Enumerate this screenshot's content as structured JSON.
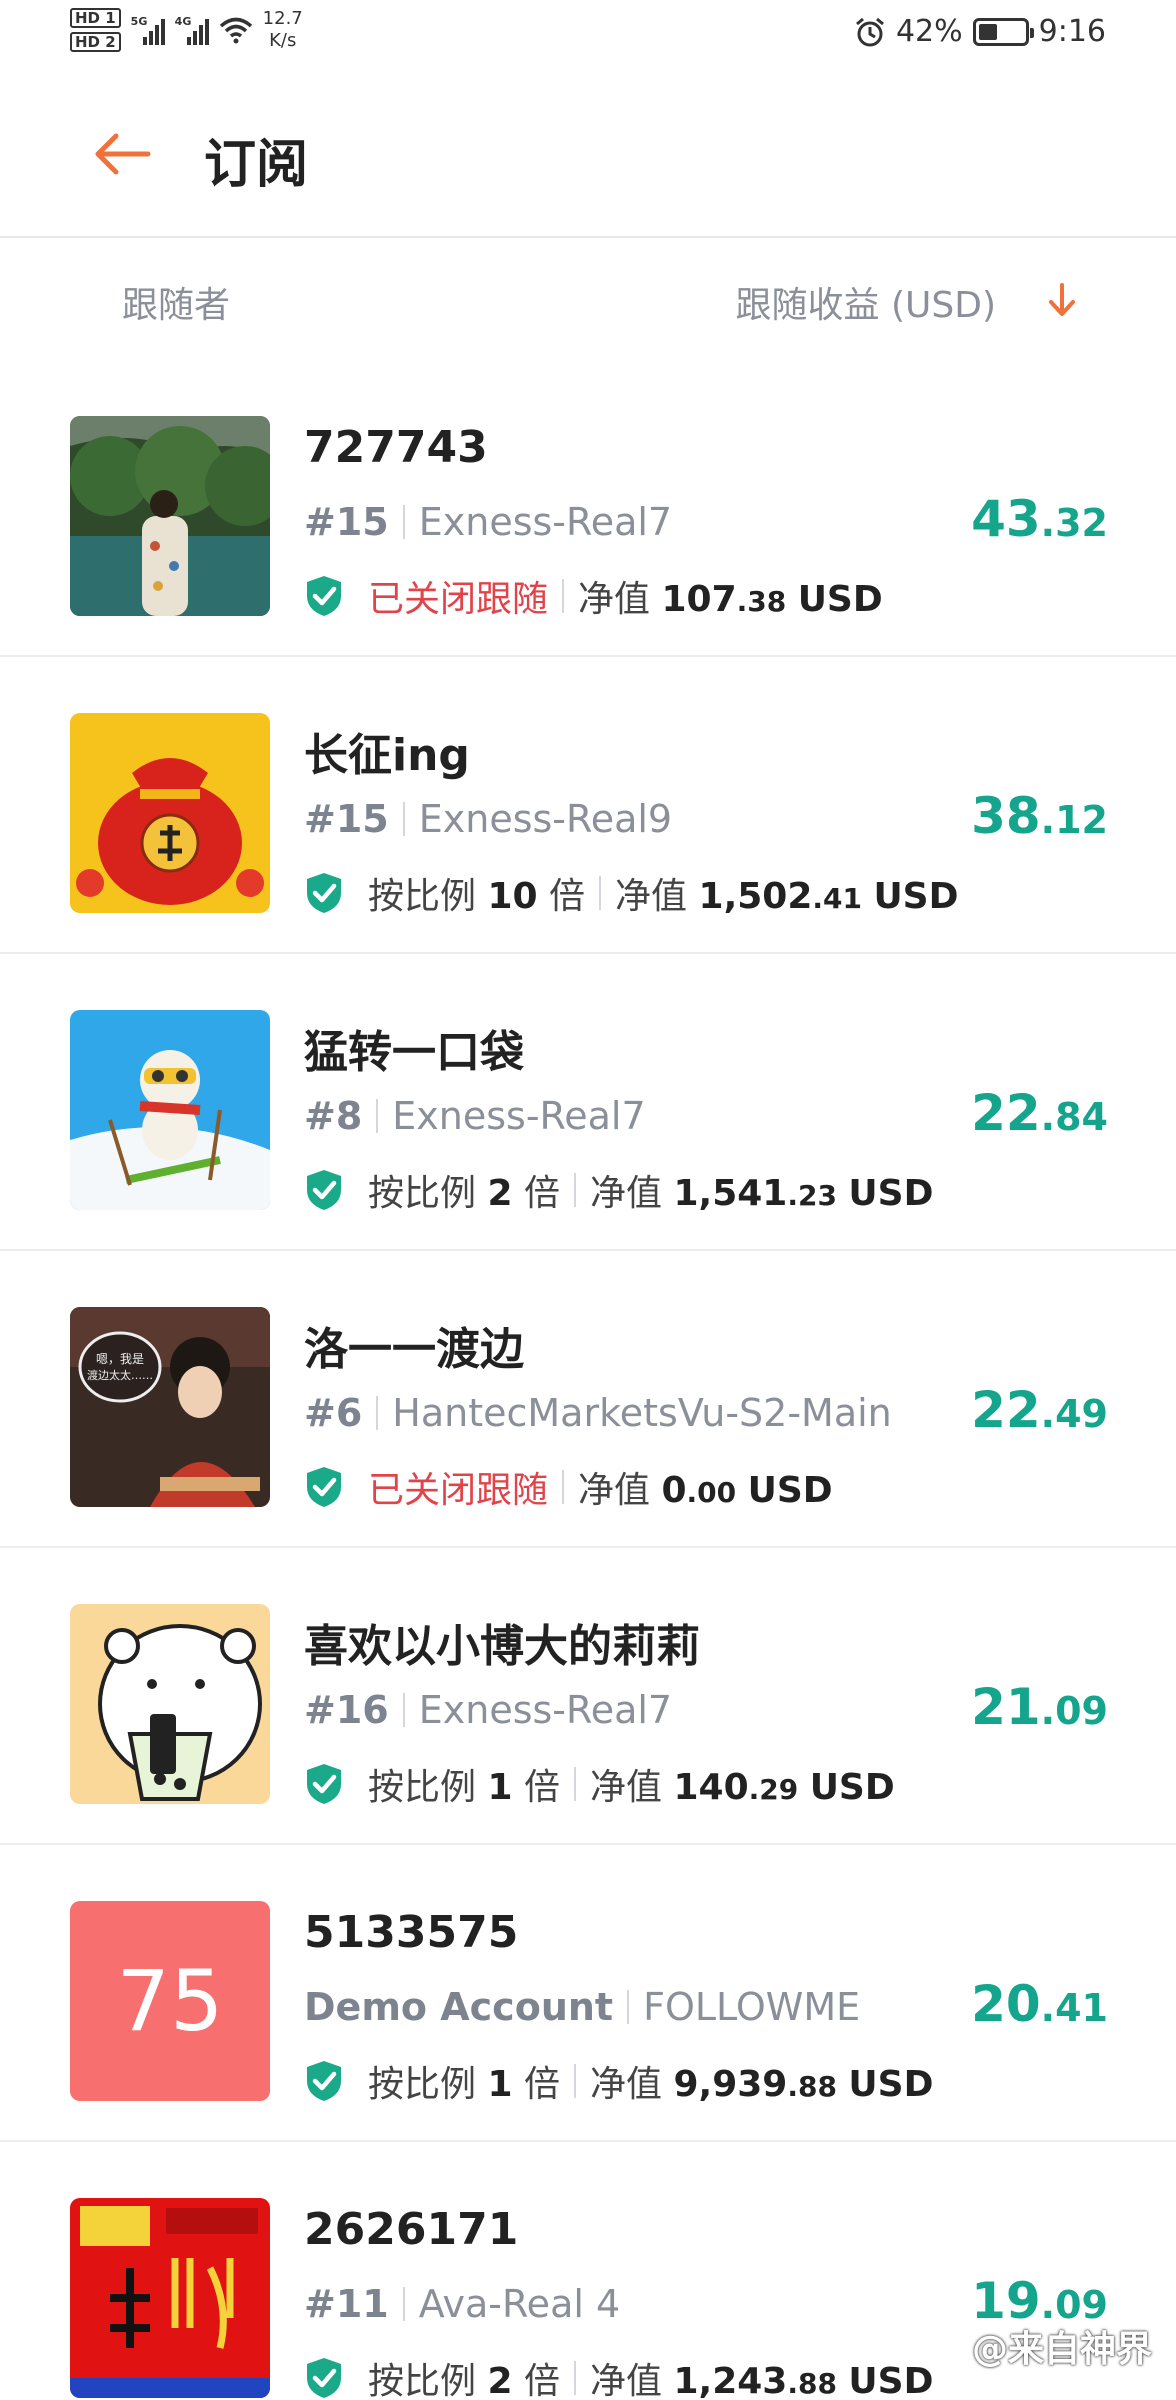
{
  "status_bar": {
    "hd1": "HD 1",
    "hd2": "HD 2",
    "sig1_tag": "5G",
    "sig2_tag": "4G",
    "speed_value": "12.7",
    "speed_unit": "K/s",
    "battery": "42%",
    "battery_level": 0.42,
    "time": "9:16"
  },
  "header": {
    "title": "订阅",
    "back_icon": "arrow-left-icon"
  },
  "columns": {
    "follower": "跟随者",
    "profit": "跟随收益 (USD)",
    "sort_icon": "arrow-down-icon"
  },
  "colors": {
    "accent": "#f0713a",
    "profit": "#15a58c",
    "closed": "#e0444a",
    "shield": "#1aa989"
  },
  "labels": {
    "equity": "净值",
    "currency": "USD"
  },
  "rows": [
    {
      "name": "727743",
      "rank": "#15",
      "server": "Exness-Real7",
      "status": "已关闭跟随",
      "equity_int": "107",
      "equity_dec": ".38",
      "profit_int": "43",
      "profit_dec": ".32"
    },
    {
      "name": "长征ing",
      "rank": "#15",
      "server": "Exness-Real9",
      "ratio_prefix": "按比例",
      "ratio_value": "10",
      "ratio_suffix": "倍",
      "equity_int": "1,502",
      "equity_dec": ".41",
      "profit_int": "38",
      "profit_dec": ".12"
    },
    {
      "name": "猛转一口袋",
      "rank": "#8",
      "server": "Exness-Real7",
      "ratio_prefix": "按比例",
      "ratio_value": "2",
      "ratio_suffix": "倍",
      "equity_int": "1,541",
      "equity_dec": ".23",
      "profit_int": "22",
      "profit_dec": ".84"
    },
    {
      "name": "洛一一渡边",
      "rank": "#6",
      "server": "HantecMarketsVu-S2-Main",
      "status": "已关闭跟随",
      "equity_int": "0",
      "equity_dec": ".00",
      "profit_int": "22",
      "profit_dec": ".49",
      "avatar_caption_1": "嗯，我是",
      "avatar_caption_2": "渡边太太……"
    },
    {
      "name": "喜欢以小博大的莉莉",
      "rank": "#16",
      "server": "Exness-Real7",
      "ratio_prefix": "按比例",
      "ratio_value": "1",
      "ratio_suffix": "倍",
      "equity_int": "140",
      "equity_dec": ".29",
      "profit_int": "21",
      "profit_dec": ".09"
    },
    {
      "name": "5133575",
      "rank": "Demo Account",
      "server": "FOLLOWME",
      "ratio_prefix": "按比例",
      "ratio_value": "1",
      "ratio_suffix": "倍",
      "equity_int": "9,939",
      "equity_dec": ".88",
      "profit_int": "20",
      "profit_dec": ".41",
      "avatar_text": "75"
    },
    {
      "name": "2626171",
      "rank": "#11",
      "server": "Ava-Real 4",
      "ratio_prefix": "按比例",
      "ratio_value": "2",
      "ratio_suffix": "倍",
      "equity_int": "1,243",
      "equity_dec": ".88",
      "profit_int": "19",
      "profit_dec": ".09"
    }
  ],
  "watermark": "@来自神界"
}
